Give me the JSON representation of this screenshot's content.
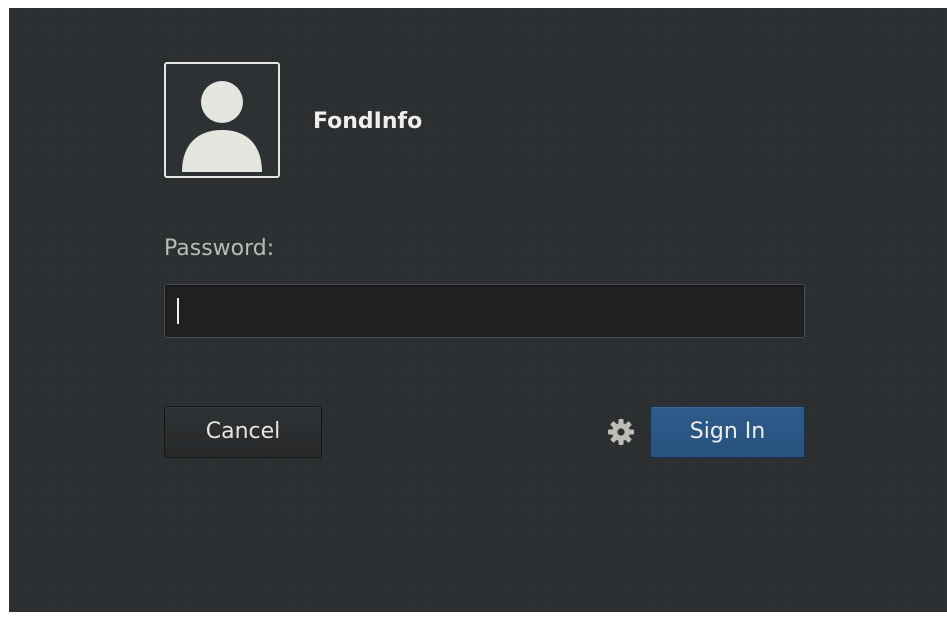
{
  "user": {
    "name": "FondInfo",
    "avatar_icon": "user-silhouette-icon"
  },
  "password": {
    "label": "Password:",
    "value": "",
    "placeholder": ""
  },
  "actions": {
    "cancel_label": "Cancel",
    "signin_label": "Sign In",
    "settings_icon": "gear-icon"
  },
  "colors": {
    "background": "#2b2e30",
    "accent": "#2e5b8b",
    "text": "#eeeeec",
    "muted_text": "#b9bbb6"
  }
}
